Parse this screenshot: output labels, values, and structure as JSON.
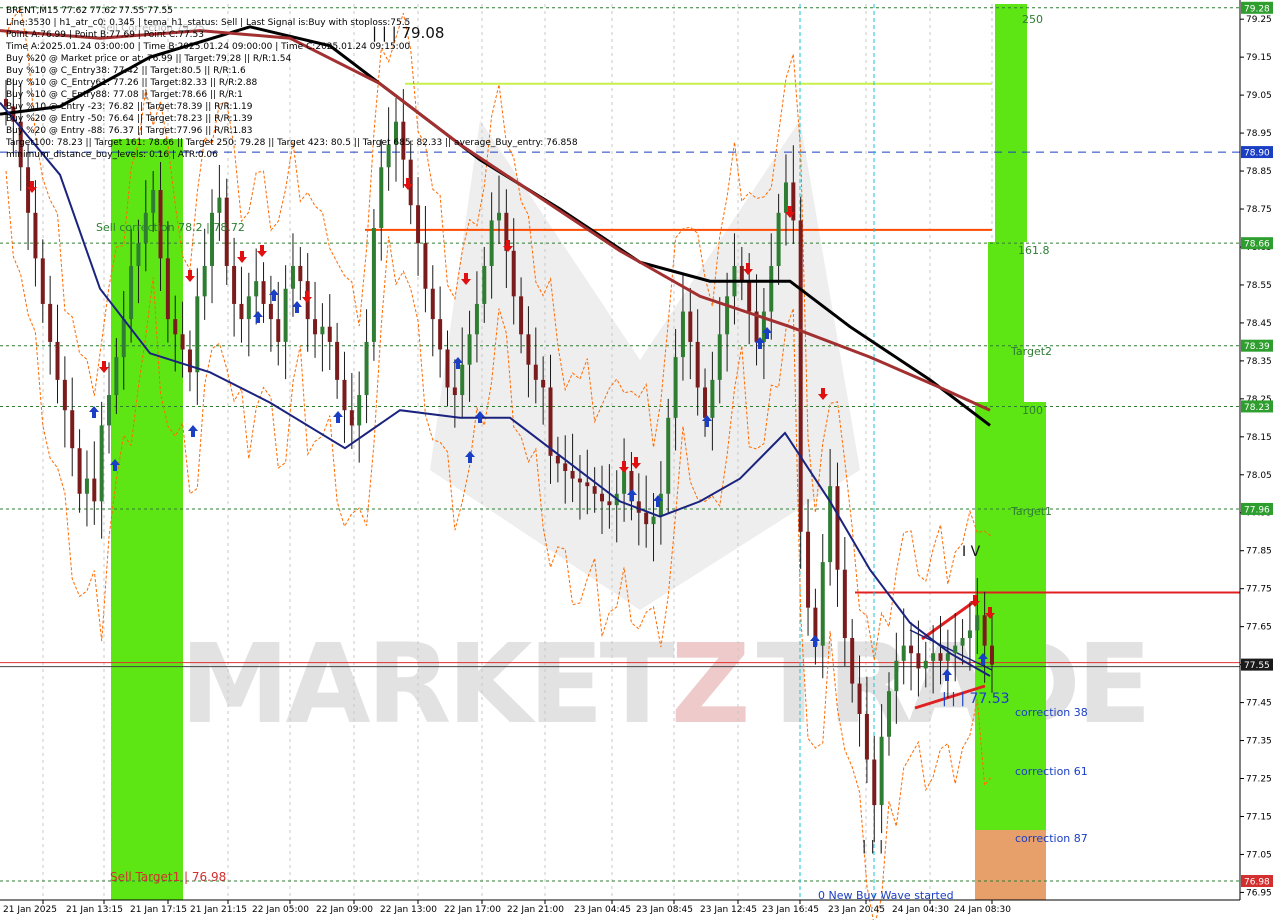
{
  "chart_data": {
    "type": "candlestick",
    "symbol_line": "BRENT,M15  77.62 77.62 77.55 77.55",
    "info_lines": [
      "Line:3530 | h1_atr_c0: 0.345 | tema_h1_status: Sell | Last Signal is:Buy with stoploss:75.5",
      "Point A:76.99 | Point B:77.69 | Point C:77.53",
      "Time A:2025.01.24 03:00:00 | Time B:2025.01.24 09:00:00 | Time C:2025.01.24 09:15:00",
      "Buy %20 @ Market price or at: 76.99 || Target:79.28 || R/R:1.54",
      "Buy %10 @ C_Entry38: 77.42 || Target:80.5 || R/R:1.6",
      "Buy %10 @ C_Entry61: 77.26 || Target:82.33 || R/R:2.88",
      "Buy %10 @ C_Entry88: 77.08 || Target:78.66 || R/R:1",
      "Buy %10 @ Entry -23: 76.82 || Target:78.39 || R/R:1.19",
      "Buy %20 @ Entry -50: 76.64 || Target:78.23 || R/R:1.39",
      "Buy %20 @ Entry -88: 76.37 || Target:77.96 || R/R:1.83",
      "Target100: 78.23 || Target 161: 78.66 || Target 250: 79.28 || Target 423: 80.5 || Target 685: 82.33 || average_Buy_entry: 76.858",
      "minimum_distance_buy_levels: 0.16 | ATR:0.06"
    ],
    "x_labels": [
      "21 Jan 2025",
      "21 Jan 13:15",
      "21 Jan 17:15",
      "21 Jan 21:15",
      "22 Jan 05:00",
      "22 Jan 09:00",
      "22 Jan 13:00",
      "22 Jan 17:00",
      "22 Jan 21:00",
      "23 Jan 04:45",
      "23 Jan 08:45",
      "23 Jan 12:45",
      "23 Jan 16:45",
      "23 Jan 20:45",
      "24 Jan 04:30",
      "24 Jan 08:30"
    ],
    "y_ticks": [
      "79.25",
      "79.15",
      "79.05",
      "78.95",
      "78.85",
      "78.75",
      "78.65",
      "78.55",
      "78.45",
      "78.35",
      "78.25",
      "78.15",
      "78.05",
      "77.95",
      "77.85",
      "77.75",
      "77.65",
      "77.55",
      "77.45",
      "77.35",
      "77.25",
      "77.15",
      "77.05",
      "76.95"
    ],
    "ylim": [
      76.93,
      79.29
    ],
    "price_tags": [
      {
        "value": "79.28",
        "color": "#2e9e2e"
      },
      {
        "value": "78.90",
        "color": "#1a3fc4"
      },
      {
        "value": "78.66",
        "color": "#2e9e2e"
      },
      {
        "value": "78.39",
        "color": "#2e9e2e"
      },
      {
        "value": "78.23",
        "color": "#2e9e2e"
      },
      {
        "value": "77.96",
        "color": "#2e9e2e"
      },
      {
        "value": "77.55",
        "color": "#1a1a1a"
      },
      {
        "value": "76.98",
        "color": "#d32f2f"
      }
    ],
    "level_labels": [
      "250",
      "161.8",
      "Target2",
      "100",
      "Target1"
    ],
    "correction_labels": [
      "correction 38",
      "correction 61",
      "correction 87"
    ],
    "annotations": {
      "top_price": "79.08",
      "sell_correction": "Sell correction 78.2 | 78.72",
      "sell_target": "Sell Target1 | 76.98",
      "wave_label": "I V",
      "point_c": "77.53",
      "new_wave": "0 New Buy Wave started",
      "faint_label": "Sell Correction 79.25"
    },
    "series": [
      {
        "name": "close",
        "values": [
          79.02,
          78.98,
          78.86,
          78.74,
          78.62,
          78.5,
          78.4,
          78.3,
          78.22,
          78.12,
          78.0,
          78.04,
          77.98,
          78.18,
          78.26,
          78.36,
          78.46,
          78.6,
          78.66,
          78.74,
          78.8,
          78.62,
          78.46,
          78.42,
          78.38,
          78.32,
          78.52,
          78.6,
          78.74,
          78.78,
          78.6,
          78.5,
          78.46,
          78.52,
          78.56,
          78.5,
          78.46,
          78.4,
          78.54,
          78.6,
          78.56,
          78.46,
          78.42,
          78.44,
          78.4,
          78.3,
          78.22,
          78.18,
          78.26,
          78.4,
          78.7,
          78.86,
          78.92,
          78.98,
          78.88,
          78.76,
          78.66,
          78.54,
          78.46,
          78.38,
          78.28,
          78.26,
          78.34,
          78.42,
          78.5,
          78.6,
          78.72,
          78.74,
          78.64,
          78.52,
          78.42,
          78.34,
          78.3,
          78.28,
          78.1,
          78.08,
          78.06,
          78.04,
          78.03,
          78.02,
          78.0,
          77.98,
          77.97,
          78.0,
          78.06,
          77.98,
          77.95,
          77.92,
          77.94,
          78.0,
          78.2,
          78.36,
          78.48,
          78.4,
          78.28,
          78.2,
          78.3,
          78.42,
          78.52,
          78.6,
          78.56,
          78.48,
          78.4,
          78.48,
          78.6,
          78.74,
          78.82,
          78.72,
          77.9,
          77.7,
          77.6,
          77.82,
          78.02,
          77.8,
          77.62,
          77.5,
          77.42,
          77.3,
          77.18,
          77.36,
          77.48,
          77.56,
          77.6,
          77.58,
          77.54,
          77.56,
          77.58,
          77.56,
          77.58,
          77.6,
          77.62,
          77.64,
          77.68,
          77.6,
          77.55
        ]
      },
      {
        "name": "ma_black",
        "values": [
          79.03,
          78.79,
          78.6
        ]
      },
      {
        "name": "ma_red",
        "values": [
          78.9,
          78.78,
          78.58
        ]
      },
      {
        "name": "ma_blue",
        "values": [
          78.2,
          78.1,
          77.52
        ]
      }
    ],
    "colors": {
      "zone_green": "#5ee614",
      "zone_orange": "#e7a06a",
      "ma_black": "#000000",
      "ma_red": "#a33030",
      "ma_blue": "#1a237e",
      "envelope": "#ff6a00",
      "buy_arrow": "#1a3fc4",
      "sell_arrow": "#e01010",
      "target_line": "#e02020"
    },
    "watermark": "MARKETZ TRADE"
  }
}
